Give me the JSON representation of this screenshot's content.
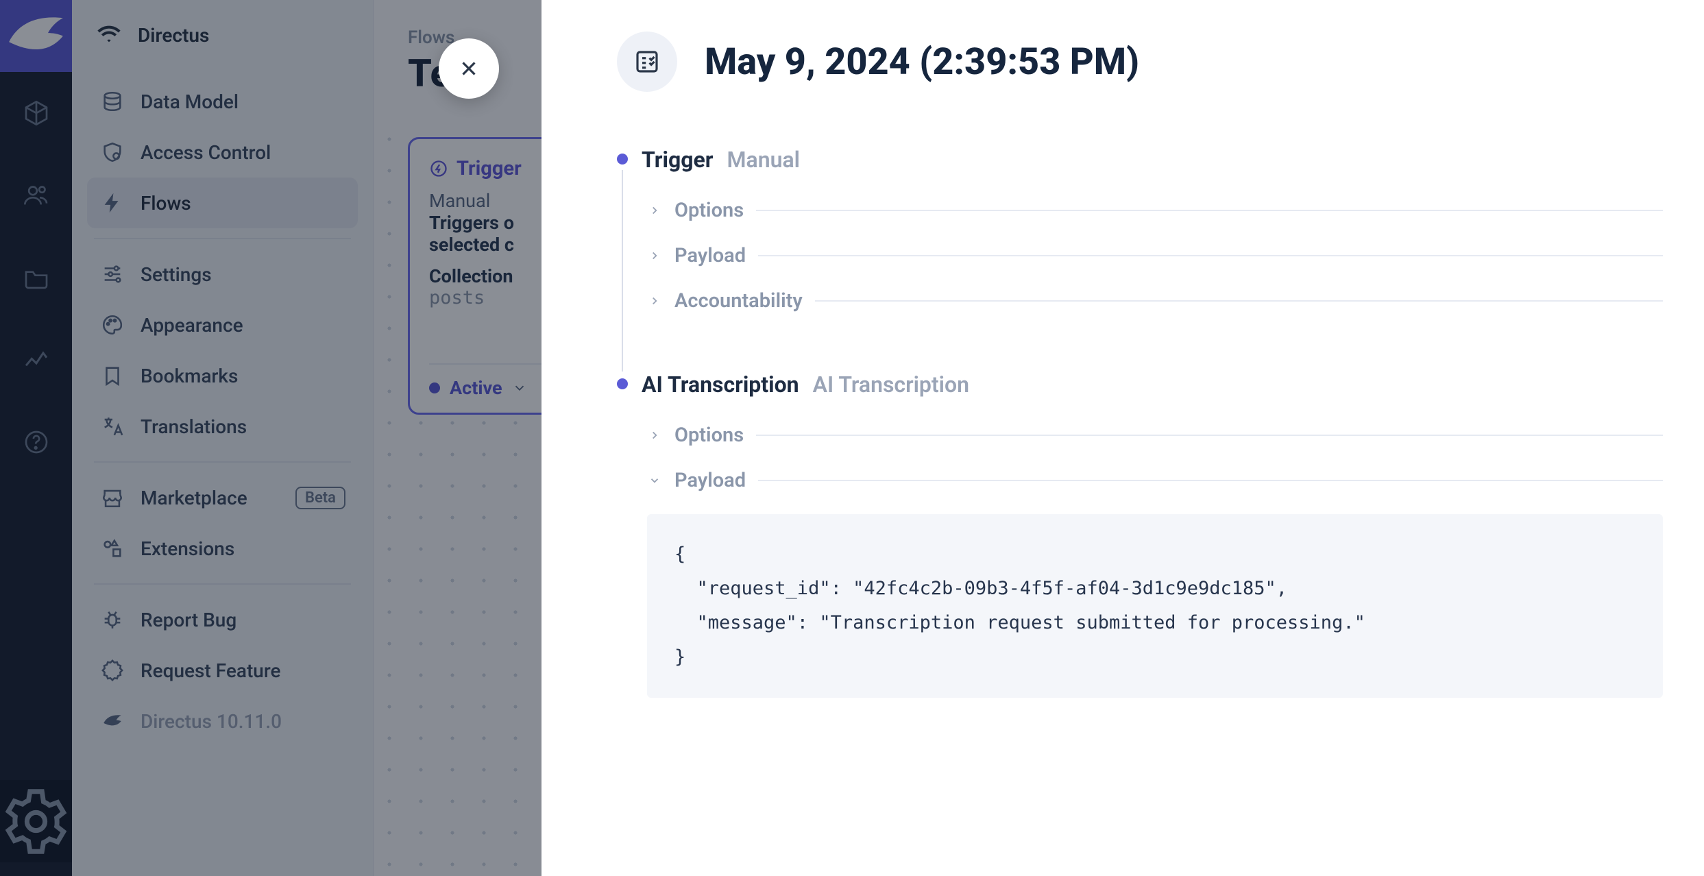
{
  "brand": "Directus",
  "version": "Directus 10.11.0",
  "sidebar": {
    "items": [
      {
        "label": "Data Model"
      },
      {
        "label": "Access Control"
      },
      {
        "label": "Flows"
      },
      {
        "label": "Settings"
      },
      {
        "label": "Appearance"
      },
      {
        "label": "Bookmarks"
      },
      {
        "label": "Translations"
      },
      {
        "label": "Marketplace",
        "badge": "Beta"
      },
      {
        "label": "Extensions"
      },
      {
        "label": "Report Bug"
      },
      {
        "label": "Request Feature"
      }
    ]
  },
  "main": {
    "breadcrumb": "Flows",
    "title": "Te",
    "card": {
      "header": "Trigger",
      "line1": "Manual",
      "line2a": "Triggers o",
      "line2b": "selected c",
      "collection_label": "Collection",
      "collection_value": "posts",
      "status": "Active"
    }
  },
  "panel": {
    "title": "May 9, 2024 (2:39:53 PM)",
    "steps": [
      {
        "name": "Trigger",
        "type": "Manual",
        "subs": [
          {
            "label": "Options",
            "expanded": false
          },
          {
            "label": "Payload",
            "expanded": false
          },
          {
            "label": "Accountability",
            "expanded": false
          }
        ]
      },
      {
        "name": "AI Transcription",
        "type": "AI Transcription",
        "subs": [
          {
            "label": "Options",
            "expanded": false
          },
          {
            "label": "Payload",
            "expanded": true
          }
        ],
        "payload_code": "{\n  \"request_id\": \"42fc4c2b-09b3-4f5f-af04-3d1c9e9dc185\",\n  \"message\": \"Transcription request submitted for processing.\"\n}"
      }
    ]
  }
}
